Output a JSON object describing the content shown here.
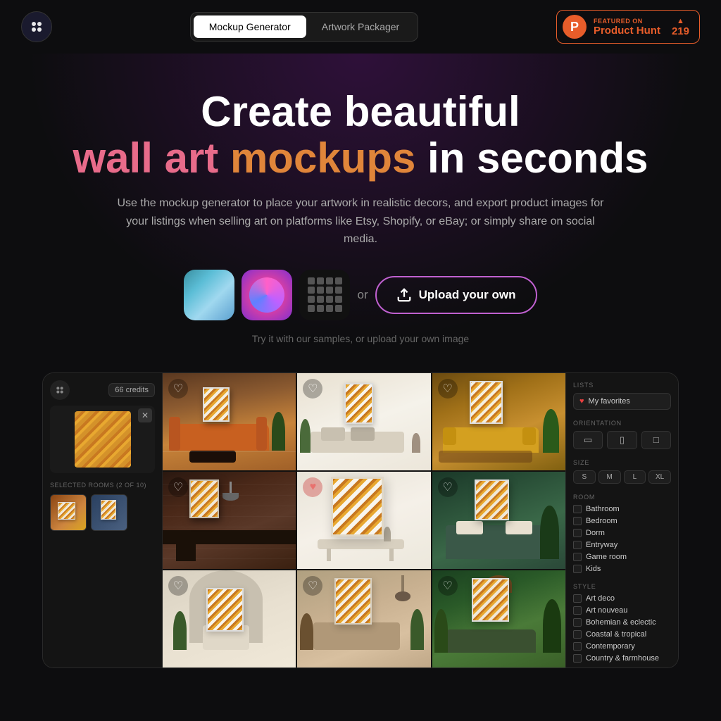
{
  "header": {
    "logo_alt": "Mockup Generator Logo",
    "nav": {
      "tab1": "Mockup Generator",
      "tab2": "Artwork Packager",
      "active": "tab1"
    },
    "product_hunt": {
      "featured_label": "FEATURED ON",
      "name": "Product Hunt",
      "count": "219",
      "logo_letter": "P"
    }
  },
  "hero": {
    "title_line1": "Create beautiful",
    "title_word1": "wall",
    "title_word2": "art",
    "title_word3": "mockups",
    "title_suffix": "in seconds",
    "subtitle": "Use the mockup generator to place your artwork in realistic decors, and export product images for your listings when selling art on platforms like Etsy, Shopify, or eBay; or simply share on social media.",
    "sample_hint": "Try it with our samples, or upload your own image",
    "upload_label": "Upload your own",
    "or_text": "or"
  },
  "app_preview": {
    "credits": "66 credits",
    "selected_label": "SELECTED ROOMS (2 OF 10)",
    "delete_label": "×",
    "rooms": [
      {
        "id": 1,
        "style": "living-orange",
        "hearted": false
      },
      {
        "id": 2,
        "style": "minimal-white",
        "hearted": false
      },
      {
        "id": 3,
        "style": "yellow-sofa",
        "hearted": false
      },
      {
        "id": 4,
        "style": "brick-wall",
        "hearted": false
      },
      {
        "id": 5,
        "style": "white-modern",
        "hearted": true
      },
      {
        "id": 6,
        "style": "green-bedroom",
        "hearted": false
      },
      {
        "id": 7,
        "style": "arch-white",
        "hearted": false
      },
      {
        "id": 8,
        "style": "boho",
        "hearted": false
      },
      {
        "id": 9,
        "style": "tropical",
        "hearted": false
      }
    ],
    "filters": {
      "lists_label": "LISTS",
      "favorites_label": "My favorites",
      "orientation_label": "ORIENTATION",
      "size_label": "SIZE",
      "sizes": [
        "S",
        "M",
        "L",
        "XL"
      ],
      "room_label": "ROOM",
      "room_options": [
        "Bathroom",
        "Bedroom",
        "Dorm",
        "Entryway",
        "Game room",
        "Kids"
      ],
      "style_label": "STYLE",
      "style_options": [
        "Art deco",
        "Art nouveau",
        "Bohemian & eclectic",
        "Coastal & tropical",
        "Contemporary",
        "Country & farmhouse"
      ]
    }
  }
}
